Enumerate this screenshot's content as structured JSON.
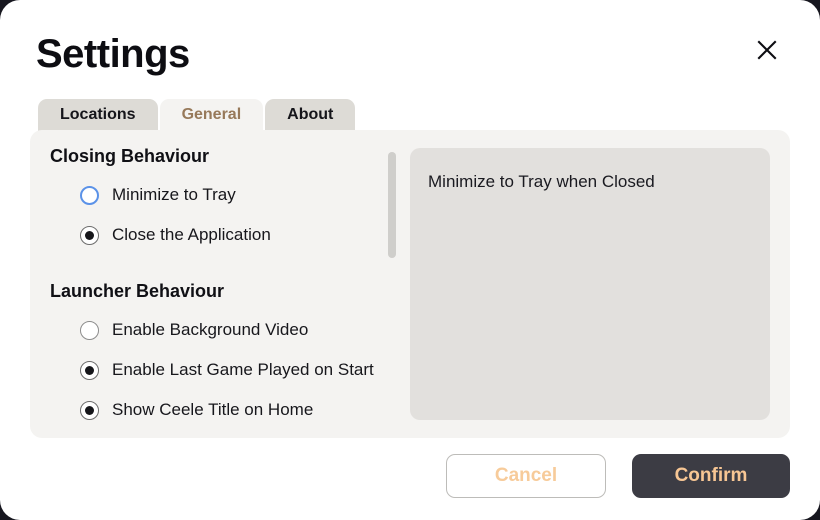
{
  "window": {
    "title": "Settings",
    "close_icon": "close-icon",
    "backdrop_color": "#17171f",
    "surface_color": "#ffffff"
  },
  "tabs": {
    "active_index": 1,
    "items": [
      {
        "label": "Locations",
        "active": false
      },
      {
        "label": "General",
        "active": true
      },
      {
        "label": "About",
        "active": false
      }
    ],
    "active_text_color": "#97795a",
    "inactive_bg_color": "#dddbd6"
  },
  "content": {
    "panel_color": "#f4f3f1",
    "groups": [
      {
        "title": "Closing Behaviour",
        "options": [
          {
            "label": "Minimize to Tray",
            "checked": false,
            "focused": true
          },
          {
            "label": "Close the Application",
            "checked": true,
            "focused": false
          }
        ]
      },
      {
        "title": "Launcher Behaviour",
        "options": [
          {
            "label": "Enable Background Video",
            "checked": false,
            "focused": false
          },
          {
            "label": "Enable Last Game Played on Start",
            "checked": true,
            "focused": false
          },
          {
            "label": "Show Ceele Title on Home",
            "checked": true,
            "focused": false
          }
        ]
      }
    ],
    "scrollbar": {
      "thumb_color": "#cfcecb",
      "name": "vertical-scrollbar"
    },
    "description": {
      "text": "Minimize to Tray when Closed",
      "panel_color": "#e2e0dd"
    }
  },
  "footer": {
    "cancel_label": "Cancel",
    "confirm_label": "Confirm",
    "accent_text_color": "#f7c694",
    "confirm_bg_color": "#3c3c44"
  }
}
